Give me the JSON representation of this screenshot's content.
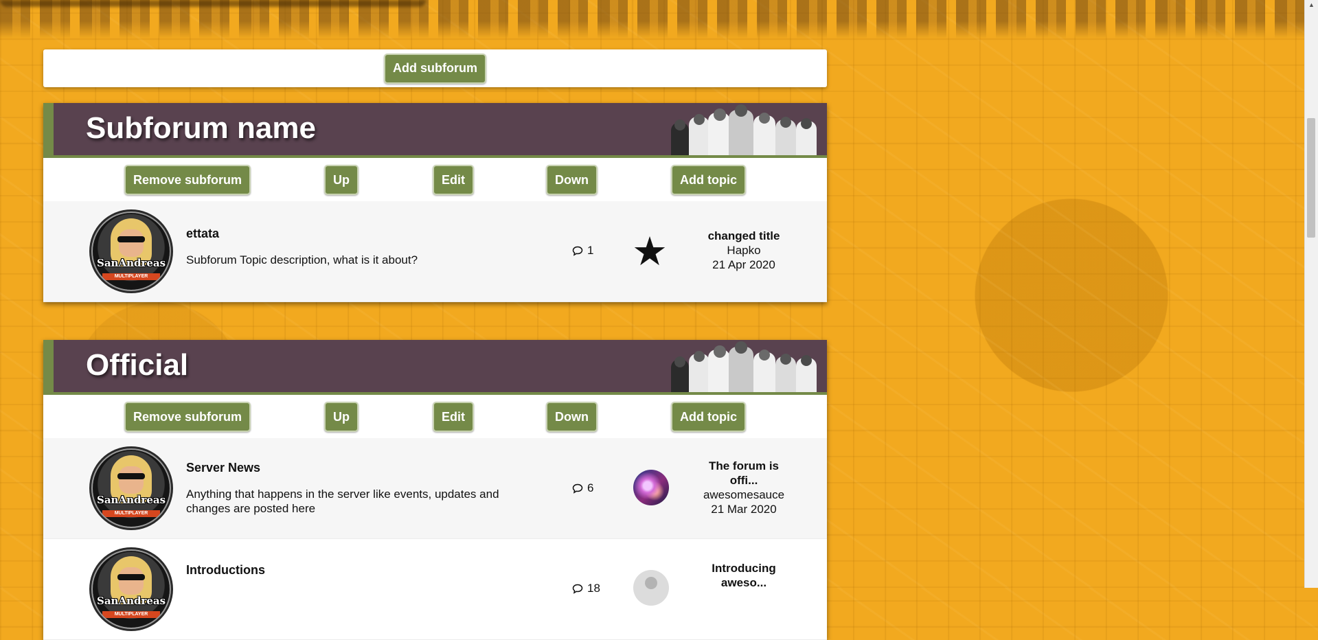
{
  "actions": {
    "add_subforum": "Add subforum"
  },
  "toolbar_labels": {
    "remove": "Remove subforum",
    "up": "Up",
    "edit": "Edit",
    "down": "Down",
    "add_topic": "Add topic"
  },
  "sections": [
    {
      "title": "Subforum name",
      "topics": [
        {
          "title": "ettata",
          "description": "Subforum Topic description, what is it about?",
          "count": "1",
          "last_title": "changed title",
          "last_user": "Hapko",
          "last_date": "21 Apr 2020",
          "logo_text": "SanAndreas",
          "logo_tag": "MULTIPLAYER"
        }
      ]
    },
    {
      "title": "Official",
      "topics": [
        {
          "title": "Server News",
          "description": "Anything that happens in the server like events, updates and changes are posted here",
          "count": "6",
          "last_title": "The forum is offi...",
          "last_user": "awesomesauce",
          "last_date": "21 Mar 2020",
          "logo_text": "SanAndreas",
          "logo_tag": "MULTIPLAYER"
        },
        {
          "title": "Introductions",
          "description": "",
          "count": "18",
          "last_title": "Introducing aweso...",
          "logo_text": "SanAndreas",
          "logo_tag": "MULTIPLAYER"
        }
      ]
    }
  ],
  "icons": {
    "comment": "speech-bubble-icon",
    "featured": "star-icon",
    "scroll_up": "chevron-up-icon"
  },
  "colors": {
    "accent_green": "#748a48",
    "header_purple": "#59424f",
    "background_orange": "#f2a91f"
  }
}
